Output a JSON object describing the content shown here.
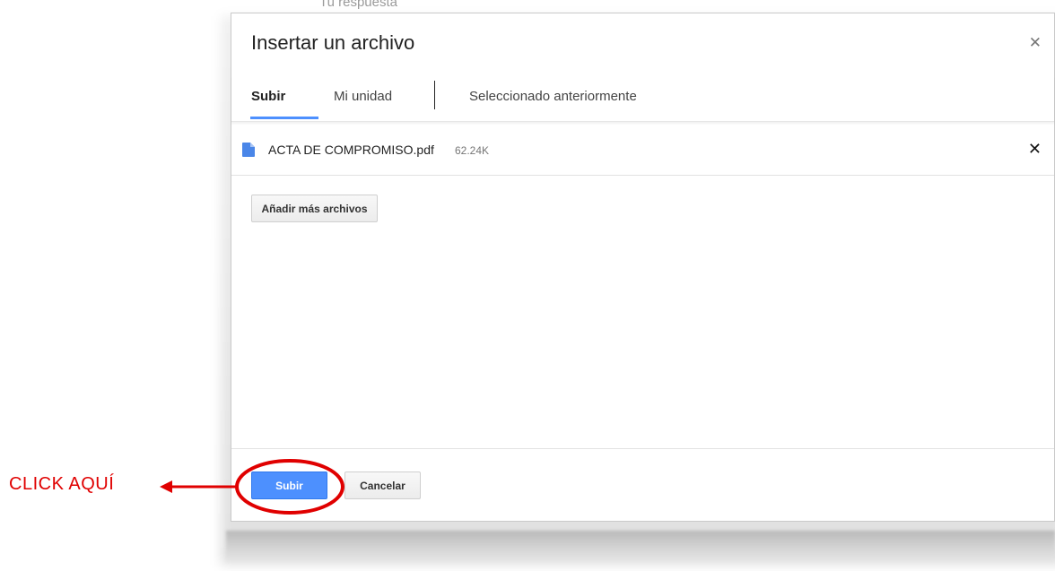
{
  "background_hint": "Tu respuesta",
  "dialog": {
    "title": "Insertar un archivo",
    "close_icon": "close-icon",
    "tabs": [
      {
        "label": "Subir",
        "active": true
      },
      {
        "label": "Mi unidad",
        "active": false
      },
      {
        "label": "Seleccionado anteriormente",
        "active": false
      }
    ],
    "file": {
      "name": "ACTA DE COMPROMISO.pdf",
      "size": "62.24K",
      "icon": "document-icon",
      "remove_icon": "remove-icon"
    },
    "add_more_label": "Añadir más archivos",
    "footer": {
      "upload_label": "Subir",
      "cancel_label": "Cancelar"
    }
  },
  "annotation": {
    "label": "CLICK AQUÍ",
    "color": "#e00000"
  },
  "colors": {
    "accent": "#4d90fe",
    "file_icon": "#4a86e8"
  }
}
